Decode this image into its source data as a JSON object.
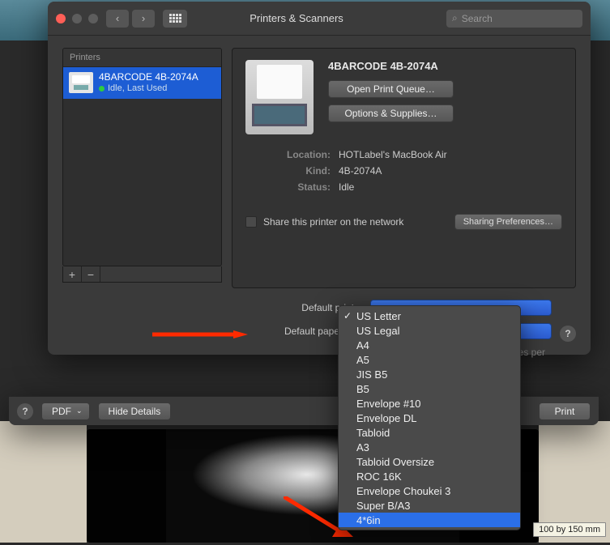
{
  "window": {
    "title": "Printers & Scanners",
    "search_placeholder": "Search"
  },
  "sidebar": {
    "header": "Printers",
    "printer": {
      "name": "4BARCODE 4B-2074A",
      "status_text": "Idle, Last Used"
    },
    "add_icon": "+",
    "remove_icon": "−"
  },
  "detail": {
    "name": "4BARCODE 4B-2074A",
    "open_queue": "Open Print Queue…",
    "options_supplies": "Options & Supplies…",
    "location_label": "Location:",
    "location_value": "HOTLabel's MacBook Air",
    "kind_label": "Kind:",
    "kind_value": "4B-2074A",
    "status_label": "Status:",
    "status_value": "Idle",
    "share_label": "Share this printer on the network",
    "sharing_prefs": "Sharing Preferences…"
  },
  "lower": {
    "default_printer_label": "Default printer:",
    "default_paper_label": "Default paper size:",
    "copies_label": "Copies per"
  },
  "dropdown": {
    "items": [
      {
        "label": "US Letter",
        "checked": true
      },
      {
        "label": "US Legal"
      },
      {
        "label": "A4"
      },
      {
        "label": "A5"
      },
      {
        "label": "JIS B5"
      },
      {
        "label": "B5"
      },
      {
        "label": "Envelope #10"
      },
      {
        "label": "Envelope DL"
      },
      {
        "label": "Tabloid"
      },
      {
        "label": "A3"
      },
      {
        "label": "Tabloid Oversize"
      },
      {
        "label": "ROC 16K"
      },
      {
        "label": "Envelope Choukei 3"
      },
      {
        "label": "Super B/A3"
      },
      {
        "label": "4*6in",
        "hover": true
      }
    ]
  },
  "print_bar": {
    "pdf": "PDF",
    "hide": "Hide Details",
    "print": "Print"
  },
  "tooltip": "100 by 150 mm",
  "help": "?"
}
